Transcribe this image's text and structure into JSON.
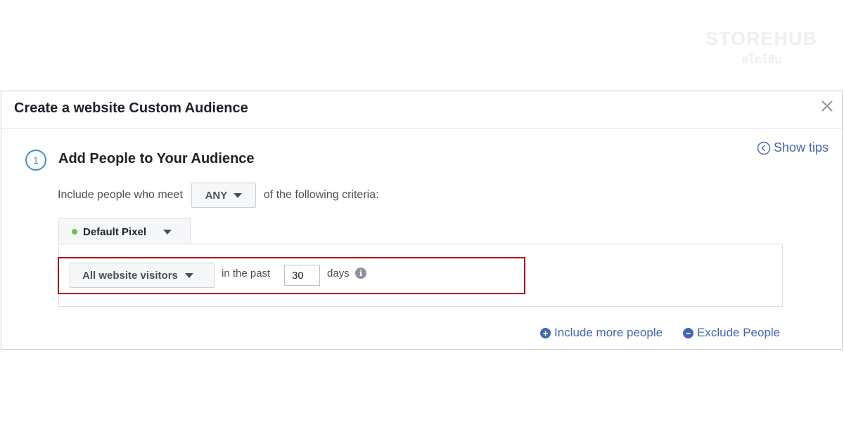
{
  "watermark": {
    "brand": "STOREHUB",
    "sub": "สโตร์ฮับ"
  },
  "dialog": {
    "title": "Create a website Custom Audience",
    "show_tips": "Show tips",
    "step": {
      "number": "1",
      "title": "Add People to Your Audience"
    },
    "criteria": {
      "prefix": "Include people who meet",
      "match": "ANY",
      "suffix": "of the following criteria:"
    },
    "pixel": {
      "label": "Default Pixel",
      "status_color": "#6fc14b"
    },
    "rule": {
      "audience_type": "All website visitors",
      "in_the_past": "in the past",
      "days_value": "30",
      "days_label": "days"
    },
    "links": {
      "include_more": "Include more people",
      "exclude": "Exclude People"
    }
  },
  "colors": {
    "link": "#4267b2",
    "highlight": "#b0141a",
    "step": "#3b8fd9"
  }
}
